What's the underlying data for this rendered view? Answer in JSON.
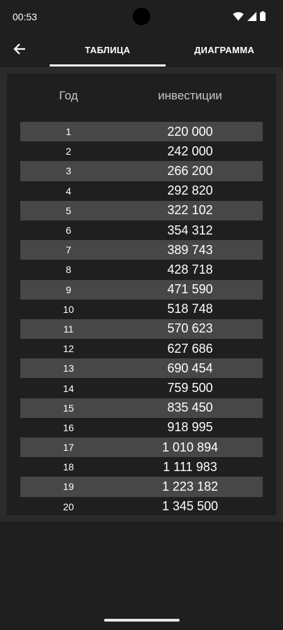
{
  "status_bar": {
    "time": "00:53",
    "icons": [
      "wifi-icon",
      "signal-icon",
      "battery-icon"
    ]
  },
  "app_bar": {
    "back_icon": "arrow-left-icon",
    "tabs": [
      {
        "label": "ТАБЛИЦА",
        "selected": true
      },
      {
        "label": "ДИАГРАММА",
        "selected": false
      }
    ]
  },
  "table": {
    "headers": {
      "year": "Год",
      "investments": "инвестиции"
    },
    "rows": [
      {
        "year": "1",
        "value": "220 000"
      },
      {
        "year": "2",
        "value": "242 000"
      },
      {
        "year": "3",
        "value": "266 200"
      },
      {
        "year": "4",
        "value": "292 820"
      },
      {
        "year": "5",
        "value": "322 102"
      },
      {
        "year": "6",
        "value": "354 312"
      },
      {
        "year": "7",
        "value": "389 743"
      },
      {
        "year": "8",
        "value": "428 718"
      },
      {
        "year": "9",
        "value": "471 590"
      },
      {
        "year": "10",
        "value": "518 748"
      },
      {
        "year": "11",
        "value": "570 623"
      },
      {
        "year": "12",
        "value": "627 686"
      },
      {
        "year": "13",
        "value": "690 454"
      },
      {
        "year": "14",
        "value": "759 500"
      },
      {
        "year": "15",
        "value": "835 450"
      },
      {
        "year": "16",
        "value": "918 995"
      },
      {
        "year": "17",
        "value": "1 010 894"
      },
      {
        "year": "18",
        "value": "1 111 983"
      },
      {
        "year": "19",
        "value": "1 223 182"
      },
      {
        "year": "20",
        "value": "1 345 500"
      }
    ]
  },
  "colors": {
    "background": "#1f1f1f",
    "panel": "#2b2b2b",
    "row_shaded": "#474747",
    "text": "#ffffff",
    "header_text": "#c8c8c8"
  }
}
